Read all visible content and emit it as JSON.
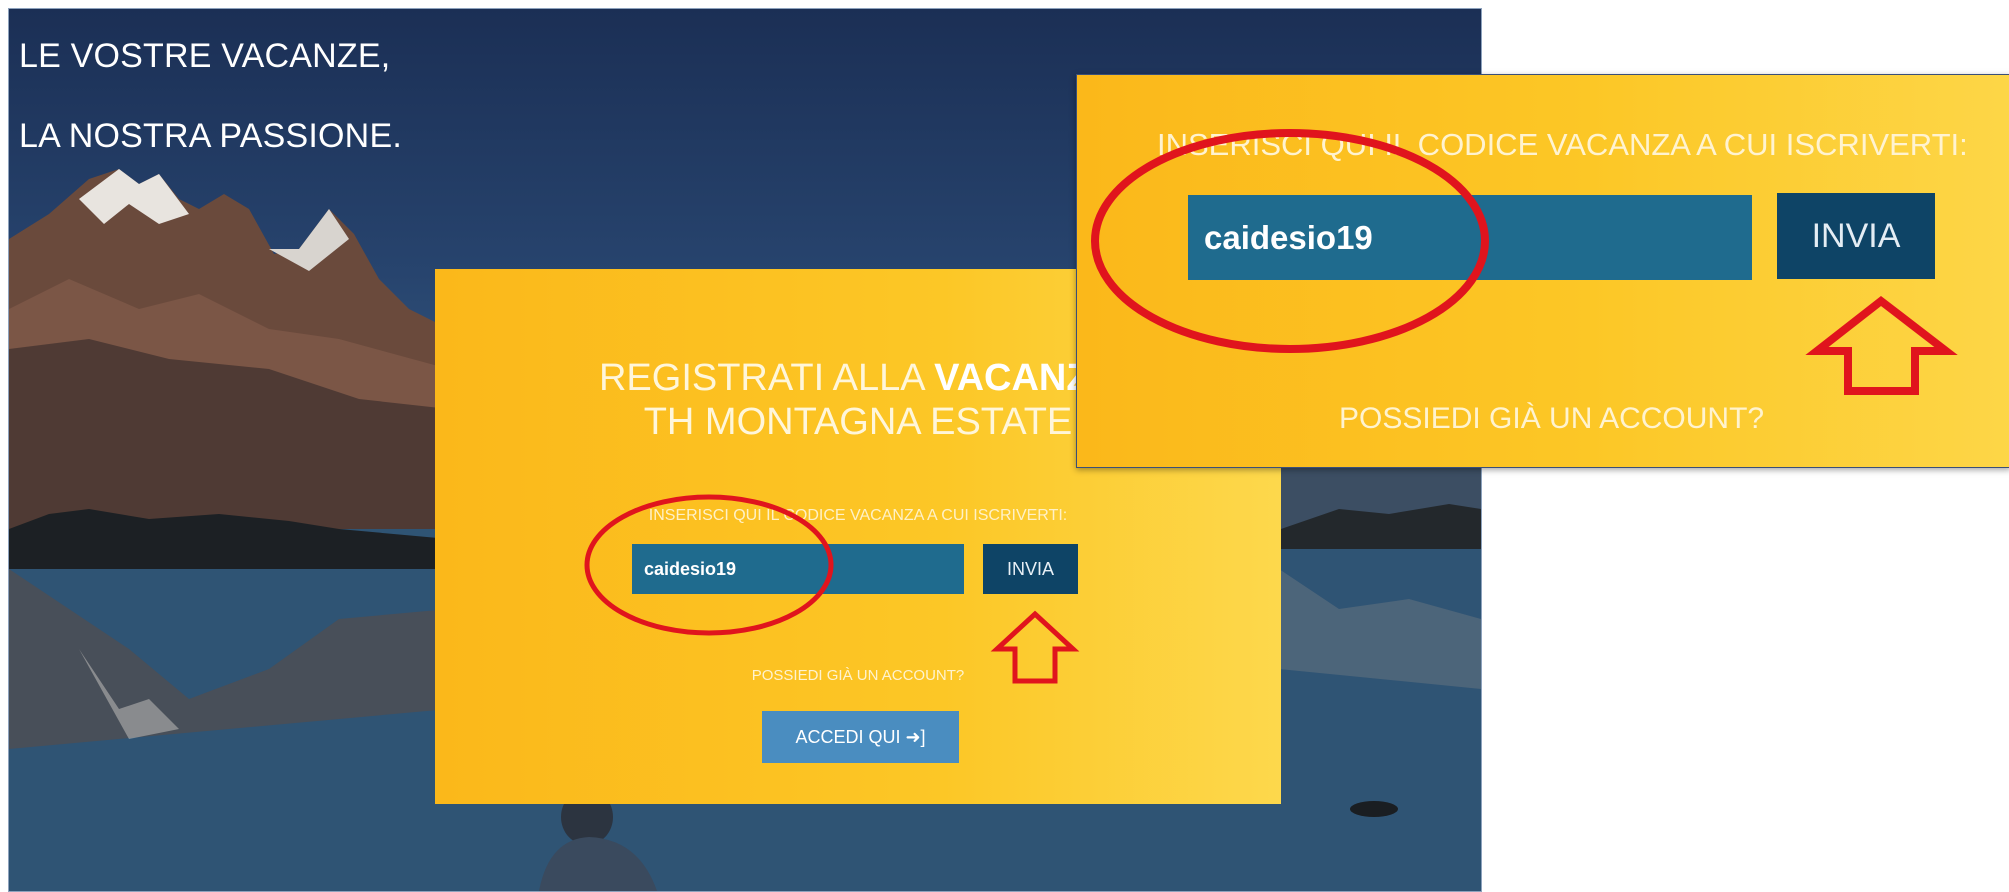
{
  "hero": {
    "tagline_line1": "LE VOSTRE VACANZE,",
    "tagline_line2": "LA NOSTRA PASSIONE."
  },
  "card": {
    "title_line1_prefix": "REGISTRATI ALLA ",
    "title_line1_bold": "VACANZA",
    "title_line2": "TH MONTAGNA ESTATE",
    "prompt": "INSERISCI QUI IL CODICE VACANZA A CUI ISCRIVERTI:",
    "code_value": "caidesio19",
    "submit_label": "INVIA",
    "account_question": "POSSIEDI GIÀ UN ACCOUNT?",
    "login_label": "ACCEDI QUI"
  },
  "zoom": {
    "prompt": "INSERISCI QUI IL CODICE VACANZA A CUI ISCRIVERTI:",
    "code_value": "caidesio19",
    "submit_label": "INVIA",
    "account_question": "POSSIEDI GIÀ UN ACCOUNT?"
  },
  "icons": {
    "login": "sign-in-icon",
    "annotation_circle": "highlight-ellipse-icon",
    "annotation_arrow": "up-arrow-icon"
  },
  "colors": {
    "card_yellow": "#fcc726",
    "input_blue": "#1f6b8e",
    "button_navy": "#0e4466",
    "login_blue": "#4a8dc0",
    "annotation_red": "#e0141d"
  }
}
